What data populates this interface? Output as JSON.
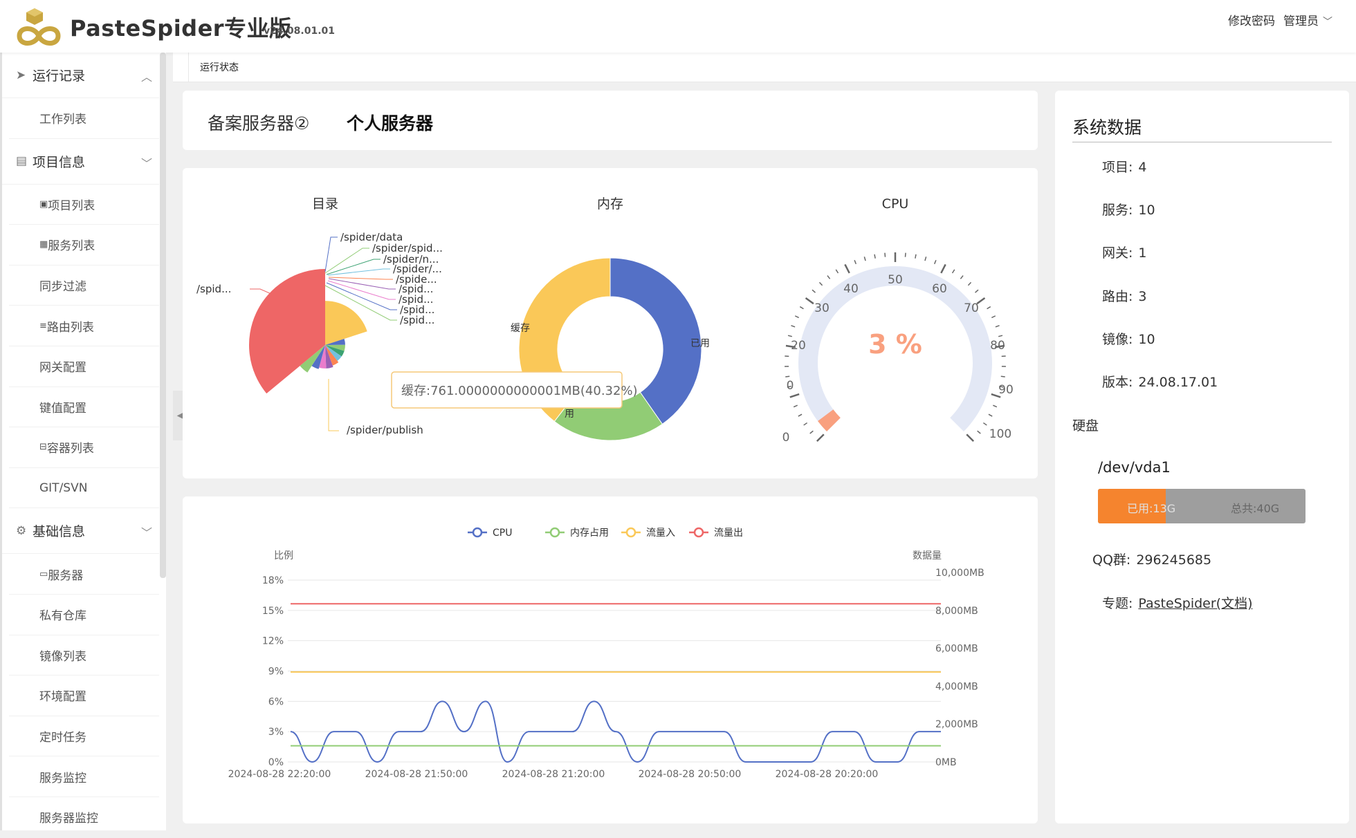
{
  "header": {
    "app_title": "PasteSpider专业版",
    "version": "v24.08.01.01",
    "change_password": "修改密码",
    "user": "管理员"
  },
  "sidebar": {
    "groups": [
      {
        "label": "运行记录",
        "icon": "send-icon",
        "items": [
          "工作列表"
        ]
      },
      {
        "label": "项目信息",
        "icon": "document-icon",
        "items": [
          "项目列表",
          "服务列表",
          "同步过滤",
          "路由列表",
          "网关配置",
          "键值配置",
          "容器列表",
          "GIT/SVN"
        ]
      },
      {
        "label": "基础信息",
        "icon": "gear-icon",
        "items": [
          "服务器",
          "私有仓库",
          "镜像列表",
          "环境配置",
          "定时任务",
          "服务监控",
          "服务器监控"
        ]
      }
    ]
  },
  "tabbar": {
    "active_tab": "运行状态"
  },
  "server_tabs": [
    "备案服务器②",
    "个人服务器"
  ],
  "charts": {
    "dir_title": "目录",
    "mem_title": "内存",
    "cpu_title": "CPU",
    "dir_labels": [
      "/spider/data",
      "/spider/spid...",
      "/spider/n...",
      "/spider/...",
      "/spide...",
      "/spid...",
      "/spid...",
      "/spid...",
      "/spid...",
      "/spid...",
      "/spider/publish"
    ],
    "mem_labels": {
      "used": "已用",
      "cache": "缓存",
      "free_partial": "用"
    },
    "tooltip": "缓存:761.0000000000001MB(40.32%)",
    "cpu_value_text": "3 %",
    "cpu_ticks": [
      "0",
      "20",
      "30",
      "40",
      "50",
      "60",
      "70",
      "80",
      "90",
      "100"
    ]
  },
  "chart_data": [
    {
      "type": "pie",
      "title": "目录",
      "style": "rose",
      "categories": [
        "/spid...",
        "/spider/publish",
        "/spider/data",
        "/spider/spid...",
        "/spider/n...",
        "/spider/...",
        "/spide...",
        "/spid...",
        "/spid...",
        "/spid...",
        "/spid..."
      ],
      "values": [
        100,
        28,
        3,
        3,
        3,
        3,
        4,
        5,
        5,
        6,
        13
      ]
    },
    {
      "type": "pie",
      "title": "内存",
      "style": "donut",
      "categories": [
        "已用",
        "用",
        "缓存"
      ],
      "values": [
        761,
        380,
        746
      ]
    },
    {
      "type": "gauge",
      "title": "CPU",
      "min": 0,
      "max": 100,
      "value": 3
    },
    {
      "type": "line",
      "legend": [
        "CPU",
        "内存占用",
        "流量入",
        "流量出"
      ],
      "y_left_label": "比例",
      "y_right_label": "数据量",
      "y_left_ticks": [
        "0%",
        "3%",
        "6%",
        "9%",
        "12%",
        "15%",
        "18%"
      ],
      "y_right_ticks": [
        "0MB",
        "2,000MB",
        "4,000MB",
        "6,000MB",
        "8,000MB",
        "10,000MB"
      ],
      "x_ticks": [
        "2024-08-28 22:20:00",
        "2024-08-28 21:50:00",
        "2024-08-28 21:20:00",
        "2024-08-28 20:50:00",
        "2024-08-28 20:20:00"
      ],
      "ylim_left": [
        0,
        18
      ],
      "ylim_right": [
        0,
        10000
      ],
      "series": [
        {
          "name": "CPU",
          "color": "#5470c6",
          "values": [
            3,
            0,
            3,
            3,
            0,
            3,
            3,
            6,
            3,
            6,
            0,
            3,
            3,
            3,
            6,
            3,
            0,
            3,
            3,
            3,
            3,
            0,
            0,
            0,
            0,
            3,
            3,
            0,
            0,
            3,
            3
          ]
        },
        {
          "name": "内存占用",
          "color": "#91cc75",
          "values": [
            1.6,
            1.6,
            1.6,
            1.6,
            1.6,
            1.6,
            1.6,
            1.6,
            1.6,
            1.6,
            1.6,
            1.6,
            1.6,
            1.6,
            1.6,
            1.6,
            1.6,
            1.6,
            1.6,
            1.6,
            1.6,
            1.6,
            1.6,
            1.6,
            1.6,
            1.6,
            1.6,
            1.6,
            1.6,
            1.6,
            1.6
          ]
        },
        {
          "name": "流量入",
          "color": "#fac858",
          "values_mb": [
            4750,
            4750,
            4750,
            4750,
            4750,
            4750,
            4750,
            4750,
            4750,
            4750,
            4750,
            4750,
            4750,
            4750,
            4750,
            4750,
            4750,
            4750,
            4750,
            4750,
            4750,
            4750,
            4750,
            4750,
            4750,
            4750,
            4750,
            4750,
            4750,
            4750,
            4750
          ]
        },
        {
          "name": "流量出",
          "color": "#ee6666",
          "values_mb": [
            8350,
            8350,
            8350,
            8350,
            8350,
            8350,
            8350,
            8350,
            8350,
            8350,
            8350,
            8350,
            8350,
            8350,
            8350,
            8350,
            8350,
            8350,
            8350,
            8350,
            8350,
            8350,
            8350,
            8350,
            8350,
            8350,
            8350,
            8350,
            8350,
            8350,
            8350
          ]
        }
      ]
    }
  ],
  "sys": {
    "title": "系统数据",
    "rows": [
      {
        "k": "项目:",
        "v": "4"
      },
      {
        "k": "服务:",
        "v": "10"
      },
      {
        "k": "网关:",
        "v": "1"
      },
      {
        "k": "路由:",
        "v": "3"
      },
      {
        "k": "镜像:",
        "v": "10"
      },
      {
        "k": "版本:",
        "v": "24.08.17.01"
      }
    ],
    "disk_title": "硬盘",
    "disk_name": "/dev/vda1",
    "disk_used": "已用:13G",
    "disk_total": "总共:40G",
    "disk_used_fraction": 0.325,
    "qq_label": "QQ群:",
    "qq_value": "296245685",
    "topic_label": "专题:",
    "topic_link": "PasteSpider(文档)"
  }
}
